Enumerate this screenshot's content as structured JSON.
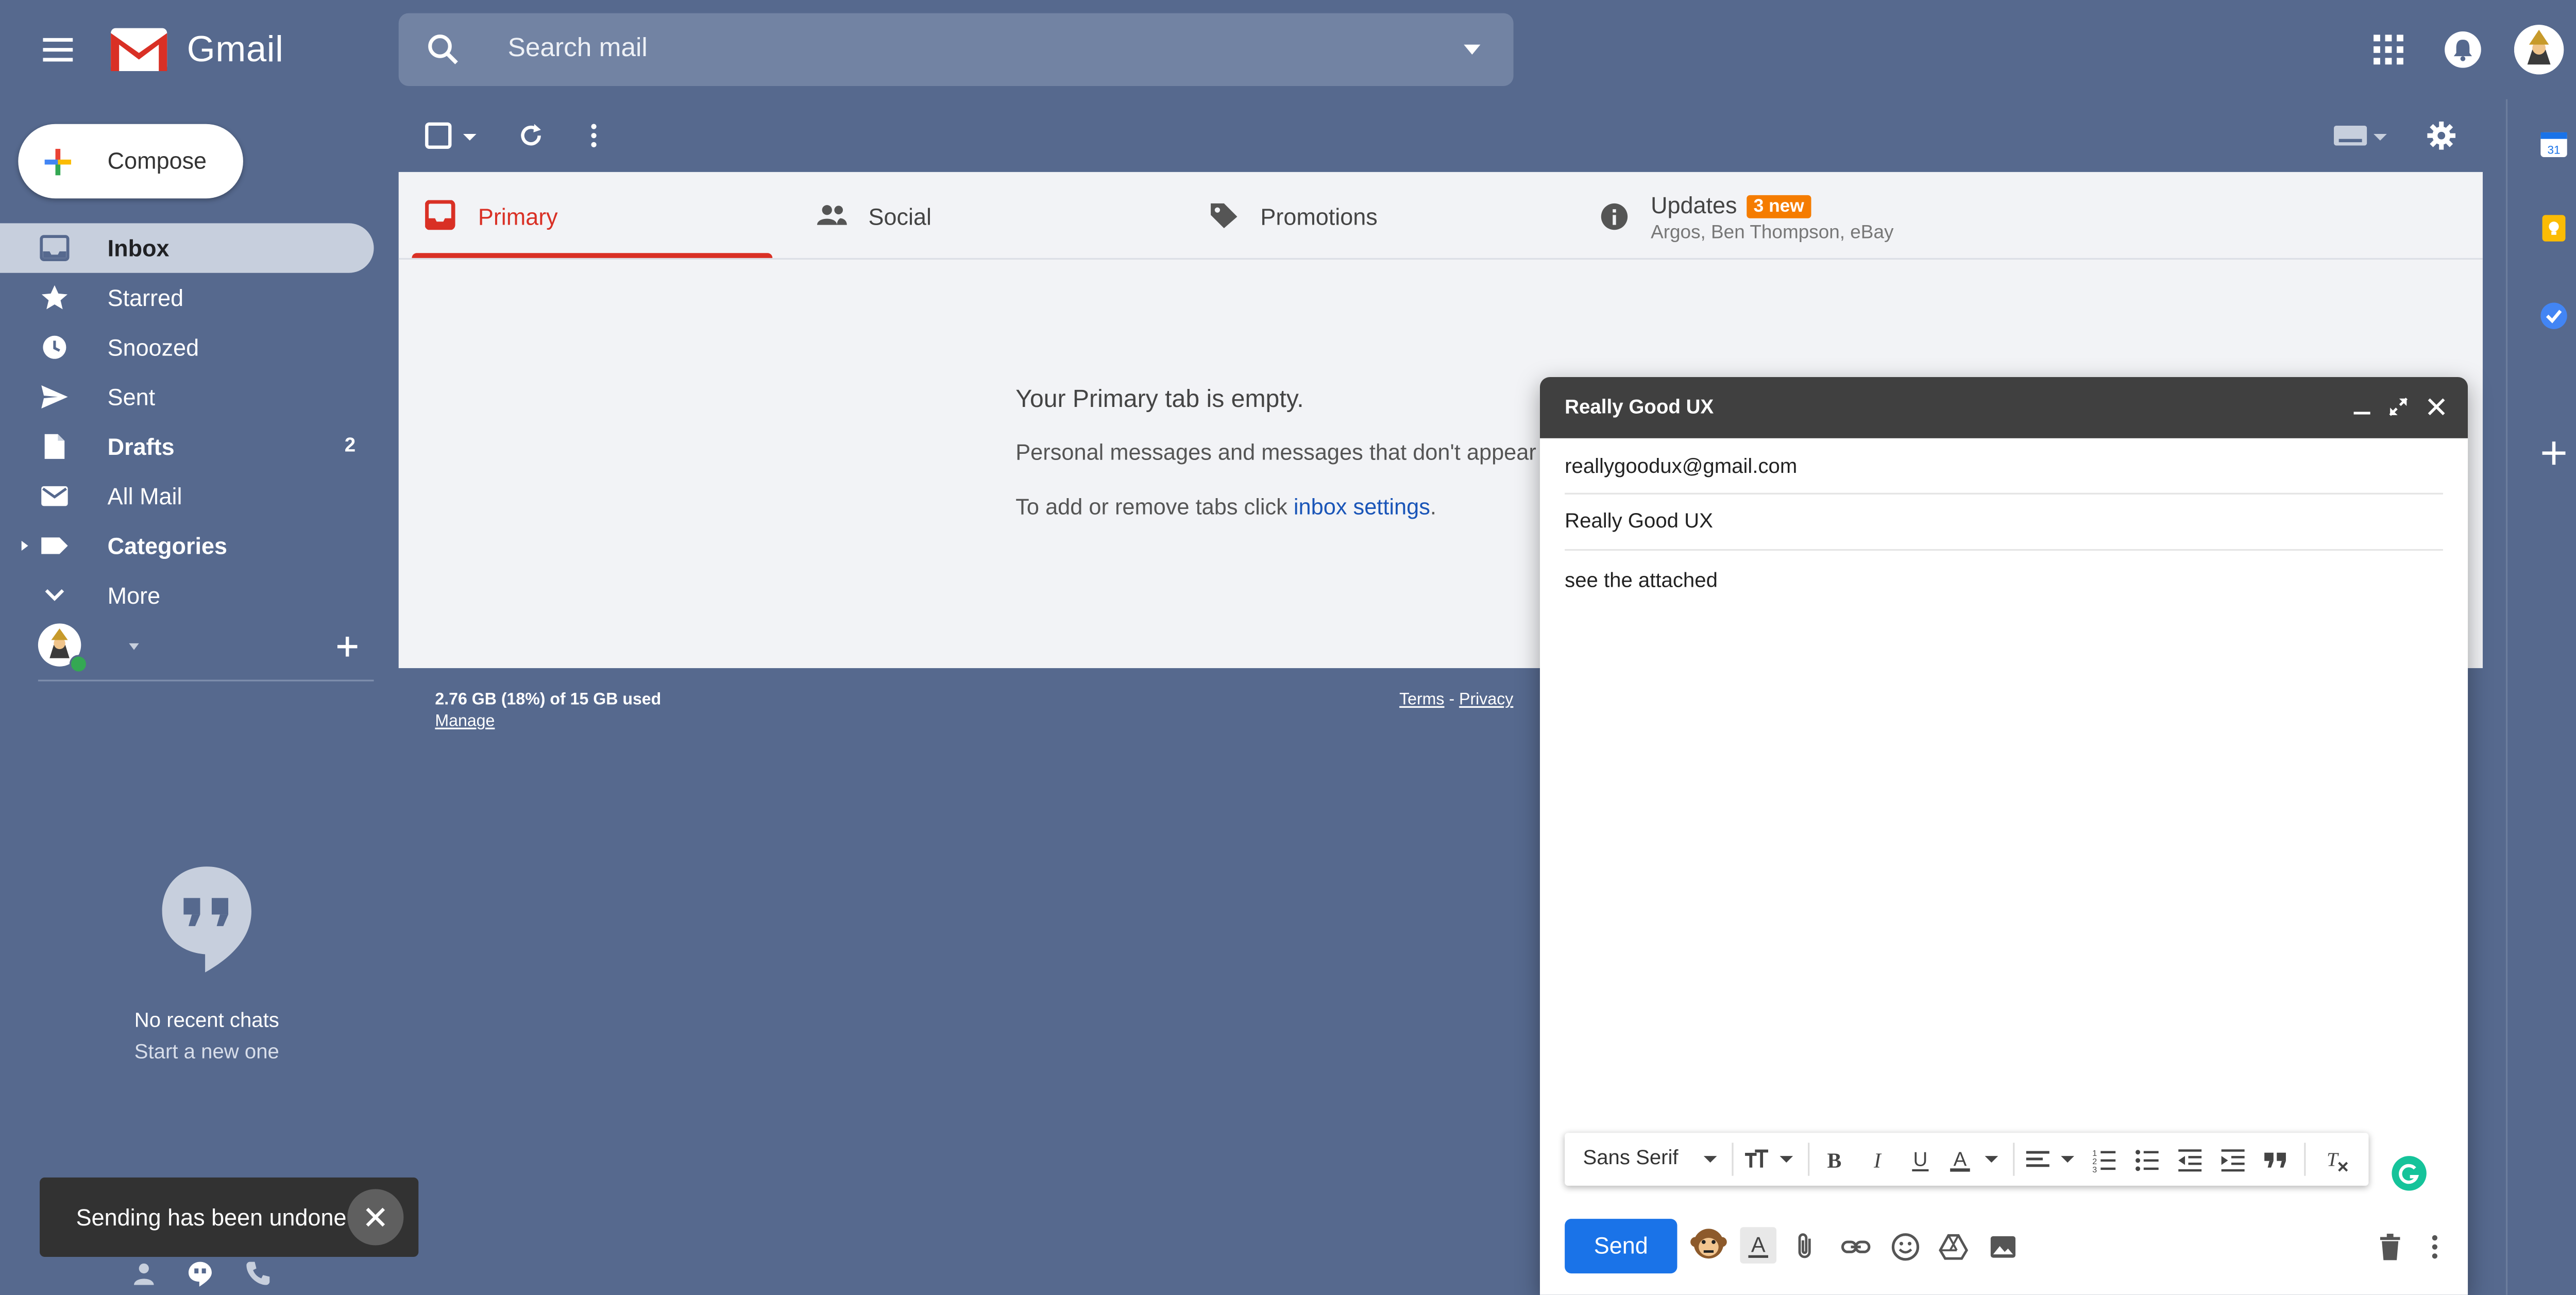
{
  "app": {
    "name": "Gmail"
  },
  "search": {
    "placeholder": "Search mail"
  },
  "compose": {
    "label": "Compose"
  },
  "nav": [
    {
      "label": "Inbox",
      "icon": "inbox-icon",
      "active": true,
      "bold": true
    },
    {
      "label": "Starred",
      "icon": "star-icon"
    },
    {
      "label": "Snoozed",
      "icon": "clock-icon"
    },
    {
      "label": "Sent",
      "icon": "send-icon"
    },
    {
      "label": "Drafts",
      "icon": "draft-icon",
      "count": "2",
      "bold": true
    },
    {
      "label": "All Mail",
      "icon": "mail-icon"
    },
    {
      "label": "Categories",
      "icon": "label-icon",
      "bold": true
    },
    {
      "label": "More",
      "icon": "chevron-down-icon"
    }
  ],
  "tabs": {
    "primary": "Primary",
    "social": "Social",
    "promotions": "Promotions",
    "updates": "Updates",
    "updates_badge": "3 new",
    "updates_senders": "Argos, Ben Thompson, eBay"
  },
  "empty": {
    "title": "Your Primary tab is empty.",
    "subtitle": "Personal messages and messages that don't appear in",
    "tabs_text": "To add or remove tabs click ",
    "tabs_link": "inbox settings",
    "tabs_end": "."
  },
  "footer": {
    "storage": "2.76 GB (18%) of 15 GB used",
    "manage": "Manage",
    "terms": "Terms",
    "sep": " - ",
    "privacy": "Privacy"
  },
  "chats": {
    "none": "No recent chats",
    "start": "Start a new one"
  },
  "toast": {
    "message": "Sending has been undone."
  },
  "compose_window": {
    "title": "Really Good UX",
    "to": "reallygoodux@gmail.com",
    "subject": "Really Good UX",
    "body": "see the attached",
    "font": "Sans Serif",
    "send_label": "Send"
  },
  "colors": {
    "accent_red": "#d93025",
    "send_blue": "#1a73e8",
    "badge_orange": "#f57c00",
    "grammarly_green": "#15c39a",
    "background": "#56698e"
  }
}
